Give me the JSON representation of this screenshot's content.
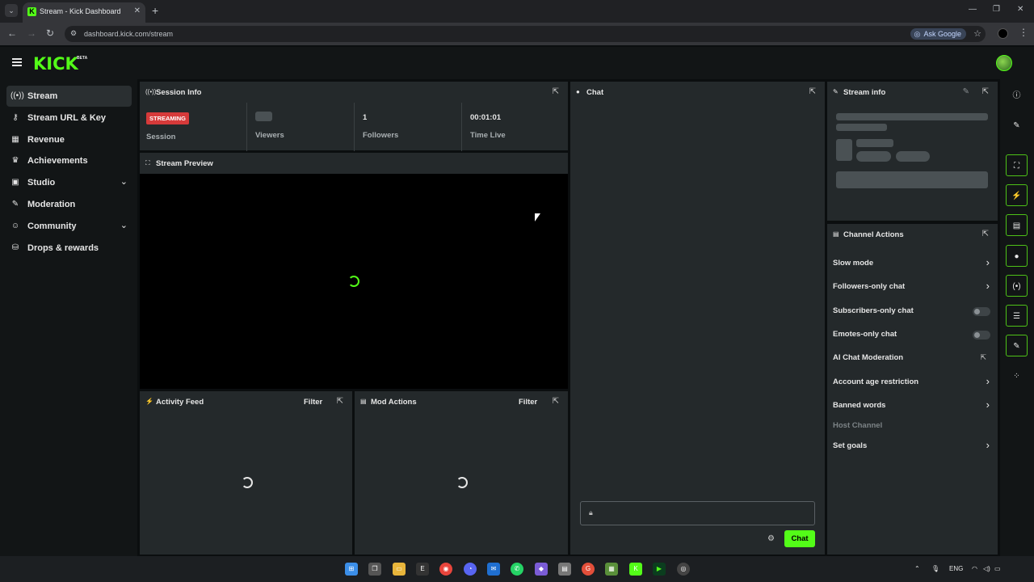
{
  "browser": {
    "tab_title": "Stream - Kick Dashboard",
    "url": "dashboard.kick.com/stream",
    "ask_google": "Ask Google"
  },
  "header": {
    "logo": "KICK",
    "logo_badge": "BETA"
  },
  "sidebar": {
    "items": [
      {
        "label": "Stream",
        "icon": "broadcast-icon",
        "glyph": "((•))",
        "active": true,
        "chevron": false
      },
      {
        "label": "Stream URL & Key",
        "icon": "key-icon",
        "glyph": "⚷",
        "active": false,
        "chevron": false
      },
      {
        "label": "Revenue",
        "icon": "chart-icon",
        "glyph": "▦",
        "active": false,
        "chevron": false
      },
      {
        "label": "Achievements",
        "icon": "trophy-icon",
        "glyph": "♛",
        "active": false,
        "chevron": false
      },
      {
        "label": "Studio",
        "icon": "camera-icon",
        "glyph": "▣",
        "active": false,
        "chevron": true
      },
      {
        "label": "Moderation",
        "icon": "wrench-icon",
        "glyph": "✎",
        "active": false,
        "chevron": false
      },
      {
        "label": "Community",
        "icon": "users-icon",
        "glyph": "☺",
        "active": false,
        "chevron": true
      },
      {
        "label": "Drops & rewards",
        "icon": "gift-icon",
        "glyph": "⛁",
        "active": false,
        "chevron": false
      }
    ]
  },
  "session_info": {
    "title": "Session Info",
    "status_badge": "STREAMING",
    "session_label": "Session",
    "viewers_label": "Viewers",
    "followers_value": "1",
    "followers_label": "Followers",
    "time_value": "00:01:01",
    "time_label": "Time Live"
  },
  "stream_preview": {
    "title": "Stream Preview"
  },
  "activity_feed": {
    "title": "Activity Feed",
    "filter": "Filter"
  },
  "mod_actions": {
    "title": "Mod Actions",
    "filter": "Filter"
  },
  "chat": {
    "title": "Chat",
    "send_label": "Chat"
  },
  "stream_info": {
    "title": "Stream info"
  },
  "channel_actions": {
    "title": "Channel Actions",
    "items": [
      {
        "label": "Slow mode",
        "control": "chevron"
      },
      {
        "label": "Followers-only chat",
        "control": "chevron"
      },
      {
        "label": "Subscribers-only chat",
        "control": "toggle"
      },
      {
        "label": "Emotes-only chat",
        "control": "toggle"
      },
      {
        "label": "AI Chat Moderation",
        "control": "external"
      },
      {
        "label": "Account age restriction",
        "control": "chevron"
      },
      {
        "label": "Banned words",
        "control": "chevron"
      },
      {
        "label": "Host Channel",
        "control": "none",
        "disabled": true
      },
      {
        "label": "Set goals",
        "control": "chevron"
      }
    ]
  },
  "right_rail": {
    "buttons": [
      "info-icon",
      "pencil-icon",
      "scan-icon",
      "lightning-icon",
      "stack-icon",
      "chat-bubble-icon",
      "broadcast-icon",
      "list-icon",
      "wrench-icon",
      "dots-icon"
    ]
  },
  "taskbar": {
    "language": "ENG"
  },
  "colors": {
    "brand": "#53fc18",
    "streaming_badge": "#d63a3a",
    "panel_bg": "#24292b",
    "page_bg": "#0b0e0f"
  }
}
